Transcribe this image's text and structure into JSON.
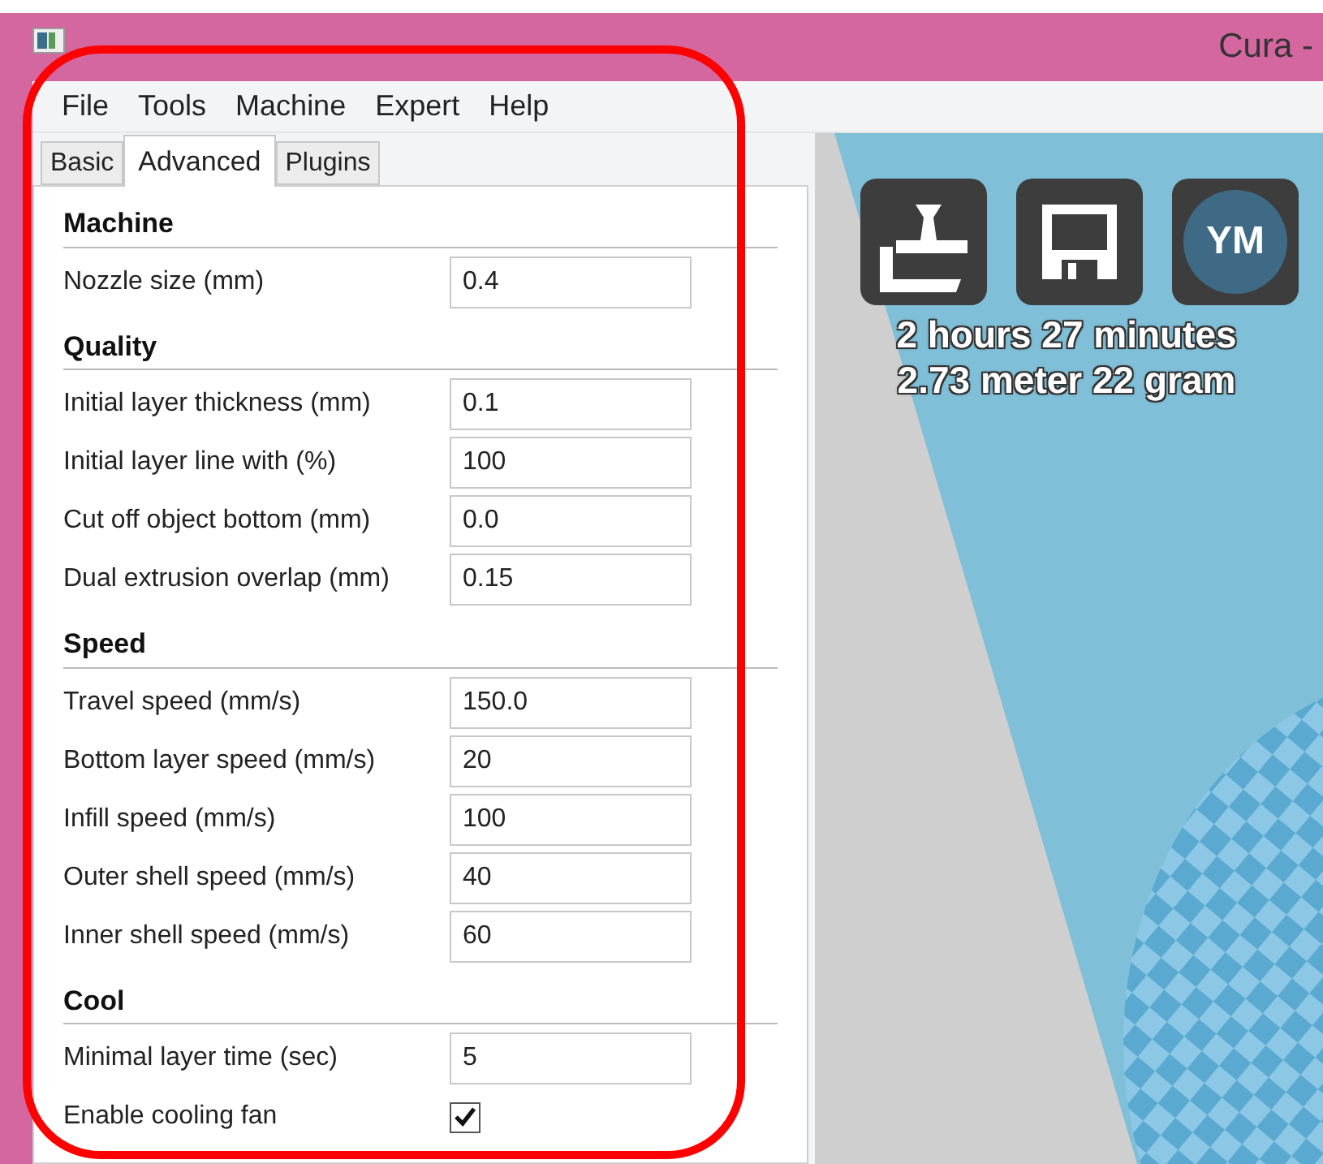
{
  "window": {
    "title": "Cura -"
  },
  "menu": [
    "File",
    "Tools",
    "Machine",
    "Expert",
    "Help"
  ],
  "tabs": [
    {
      "label": "Basic",
      "selected": false
    },
    {
      "label": "Advanced",
      "selected": true
    },
    {
      "label": "Plugins",
      "selected": false
    }
  ],
  "sections": [
    {
      "title": "Machine",
      "settings": [
        {
          "kind": "field",
          "label": "Nozzle size (mm)",
          "value": "0.4"
        }
      ]
    },
    {
      "title": "Quality",
      "settings": [
        {
          "kind": "field",
          "label": "Initial layer thickness (mm)",
          "value": "0.1"
        },
        {
          "kind": "field",
          "label": "Initial layer line with (%)",
          "value": "100"
        },
        {
          "kind": "field",
          "label": "Cut off object bottom (mm)",
          "value": "0.0"
        },
        {
          "kind": "field",
          "label": "Dual extrusion overlap (mm)",
          "value": "0.15"
        }
      ]
    },
    {
      "title": "Speed",
      "settings": [
        {
          "kind": "field",
          "label": "Travel speed (mm/s)",
          "value": "150.0"
        },
        {
          "kind": "field",
          "label": "Bottom layer speed (mm/s)",
          "value": "20"
        },
        {
          "kind": "field",
          "label": "Infill speed (mm/s)",
          "value": "100"
        },
        {
          "kind": "field",
          "label": "Outer shell speed (mm/s)",
          "value": "40"
        },
        {
          "kind": "field",
          "label": "Inner shell speed (mm/s)",
          "value": "60"
        }
      ]
    },
    {
      "title": "Cool",
      "settings": [
        {
          "kind": "field",
          "label": "Minimal layer time (sec)",
          "value": "5"
        },
        {
          "kind": "checkbox",
          "label": "Enable cooling fan",
          "checked": true
        }
      ]
    }
  ],
  "viewport": {
    "badge": "YM",
    "print_time": "2 hours 27 minutes",
    "print_material": "2.73 meter 22 gram"
  }
}
